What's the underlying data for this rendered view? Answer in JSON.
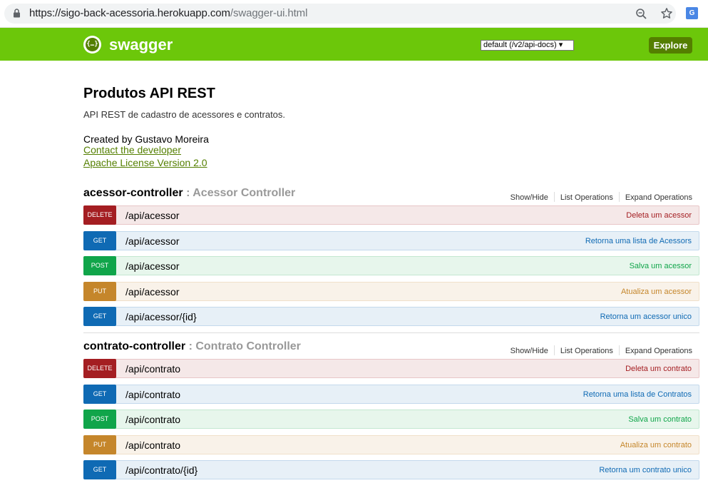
{
  "browser": {
    "url_host": "https://sigo-back-acessoria.herokuapp.com",
    "url_path": "/swagger-ui.html",
    "translate_icon_text": "G"
  },
  "header": {
    "brand": "swagger",
    "logo_text": "{…}",
    "spec_select": "default (/v2/api-docs) ▾",
    "explore_label": "Explore",
    "color": "#6cc70a"
  },
  "info": {
    "title": "Produtos API REST",
    "description": "API REST de cadastro de acessores e contratos.",
    "created_by": "Created by Gustavo Moreira",
    "contact_link": "Contact the developer",
    "license_link": "Apache License Version 2.0"
  },
  "actions": {
    "show_hide": "Show/Hide",
    "list_operations": "List Operations",
    "expand_operations": "Expand Operations"
  },
  "resources": [
    {
      "name": "acessor-controller",
      "description": ": Acessor Controller",
      "operations": [
        {
          "method": "DELETE",
          "path": "/api/acessor",
          "summary": "Deleta um acessor"
        },
        {
          "method": "GET",
          "path": "/api/acessor",
          "summary": "Retorna uma lista de Acessors"
        },
        {
          "method": "POST",
          "path": "/api/acessor",
          "summary": "Salva um acessor"
        },
        {
          "method": "PUT",
          "path": "/api/acessor",
          "summary": "Atualiza um acessor"
        },
        {
          "method": "GET",
          "path": "/api/acessor/{id}",
          "summary": "Retorna um acessor unico"
        }
      ]
    },
    {
      "name": "contrato-controller",
      "description": ": Contrato Controller",
      "operations": [
        {
          "method": "DELETE",
          "path": "/api/contrato",
          "summary": "Deleta um contrato"
        },
        {
          "method": "GET",
          "path": "/api/contrato",
          "summary": "Retorna uma lista de Contratos"
        },
        {
          "method": "POST",
          "path": "/api/contrato",
          "summary": "Salva um contrato"
        },
        {
          "method": "PUT",
          "path": "/api/contrato",
          "summary": "Atualiza um contrato"
        },
        {
          "method": "GET",
          "path": "/api/contrato/{id}",
          "summary": "Retorna um contrato unico"
        }
      ]
    }
  ]
}
